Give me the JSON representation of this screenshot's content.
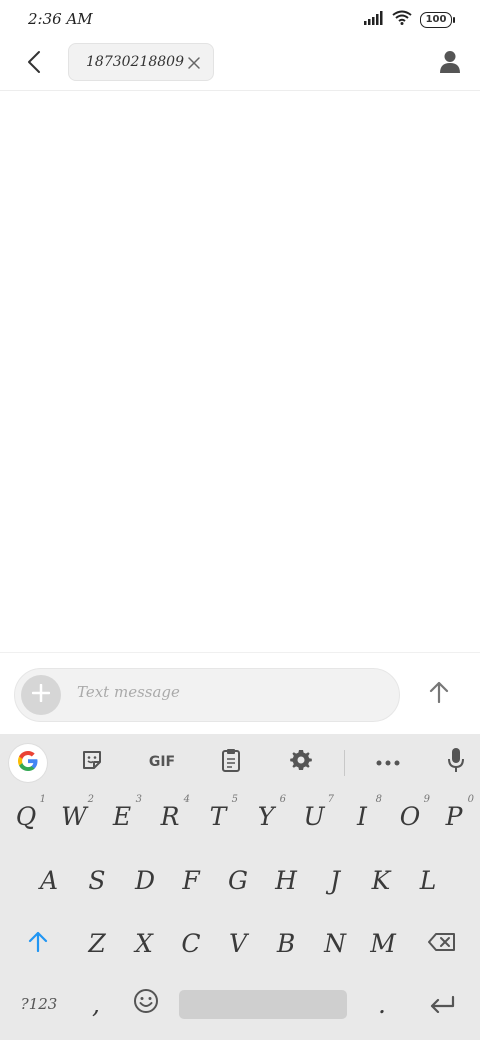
{
  "status_bar": {
    "time": "2:36 AM",
    "battery": "100"
  },
  "header": {
    "recipient": "18730218809",
    "icons": {
      "back": "back-arrow-icon",
      "remove": "close-icon",
      "contact": "person-icon"
    }
  },
  "composer": {
    "placeholder": "Text message",
    "icons": {
      "attach": "plus-icon",
      "send": "arrow-up-icon"
    }
  },
  "keyboard": {
    "toolbar": {
      "gif_label": "GIF",
      "icons": [
        "google-icon",
        "sticker-icon",
        "clipboard-icon",
        "gear-icon",
        "more-icon",
        "mic-icon"
      ]
    },
    "row1": [
      {
        "label": "Q",
        "hint": "1"
      },
      {
        "label": "W",
        "hint": "2"
      },
      {
        "label": "E",
        "hint": "3"
      },
      {
        "label": "R",
        "hint": "4"
      },
      {
        "label": "T",
        "hint": "5"
      },
      {
        "label": "Y",
        "hint": "6"
      },
      {
        "label": "U",
        "hint": "7"
      },
      {
        "label": "I",
        "hint": "8"
      },
      {
        "label": "O",
        "hint": "9"
      },
      {
        "label": "P",
        "hint": "0"
      }
    ],
    "row2": [
      "A",
      "S",
      "D",
      "F",
      "G",
      "H",
      "J",
      "K",
      "L"
    ],
    "row3": [
      "Z",
      "X",
      "C",
      "V",
      "B",
      "N",
      "M"
    ],
    "row4": {
      "symbols_label": "?123",
      "comma": ",",
      "period": "."
    },
    "accent_color": "#2196f3"
  }
}
